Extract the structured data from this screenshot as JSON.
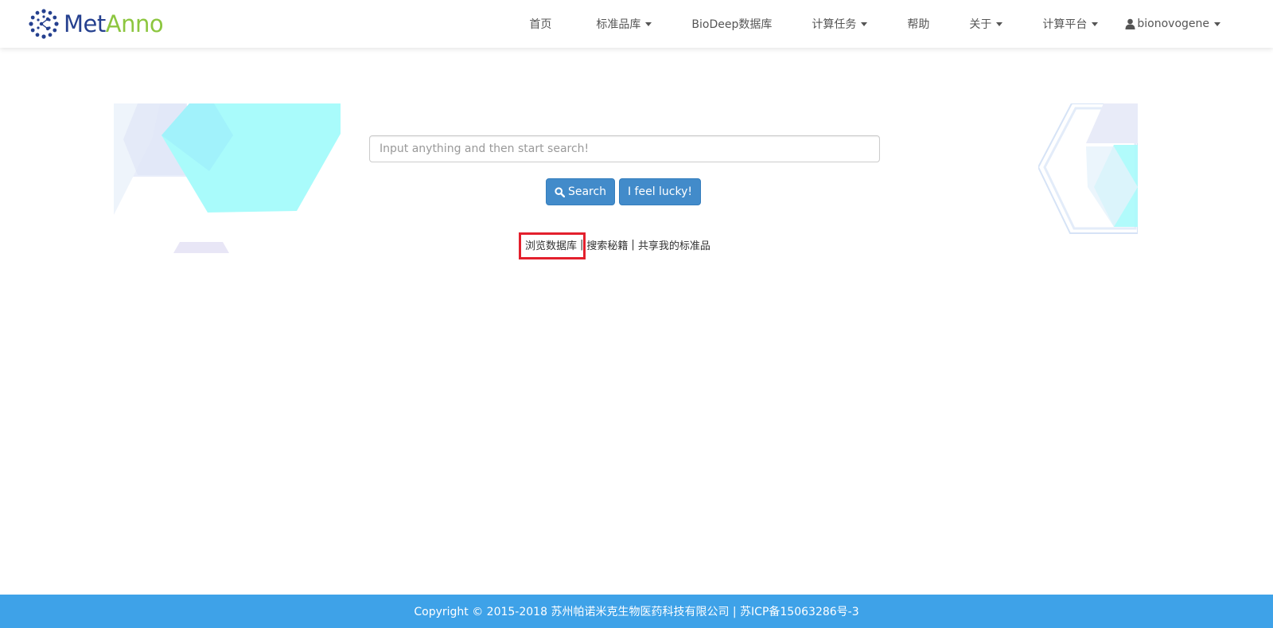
{
  "brand": {
    "part1": "Met",
    "part2": "Anno"
  },
  "nav": {
    "items": [
      {
        "label": "首页",
        "dropdown": false
      },
      {
        "label": "标准品库",
        "dropdown": true
      },
      {
        "label": "BioDeep数据库",
        "dropdown": false
      },
      {
        "label": "计算任务",
        "dropdown": true
      },
      {
        "label": "帮助",
        "dropdown": false
      },
      {
        "label": "关于",
        "dropdown": true
      },
      {
        "label": "计算平台",
        "dropdown": true
      }
    ],
    "user": "bionovogene"
  },
  "search": {
    "placeholder": "Input anything and then start search!",
    "value": "",
    "search_label": "Search",
    "lucky_label": "I feel lucky!"
  },
  "links": {
    "browse": "浏览数据库",
    "tips": "搜索秘籍",
    "share": "共享我的标准品",
    "separator": "|"
  },
  "footer": {
    "text": "Copyright © 2015-2018 苏州帕诺米克生物医药科技有限公司 | 苏ICP备15063286号-3"
  },
  "colors": {
    "primary": "#428bca",
    "footer_bg": "#3ea2e8",
    "brand_blue": "#25408f",
    "brand_green": "#8cc63f",
    "highlight": "#e3202d",
    "hex_cyan": "#a9fbfb"
  },
  "icons": [
    "logo-icon",
    "caret-down-icon",
    "user-icon",
    "search-icon"
  ]
}
